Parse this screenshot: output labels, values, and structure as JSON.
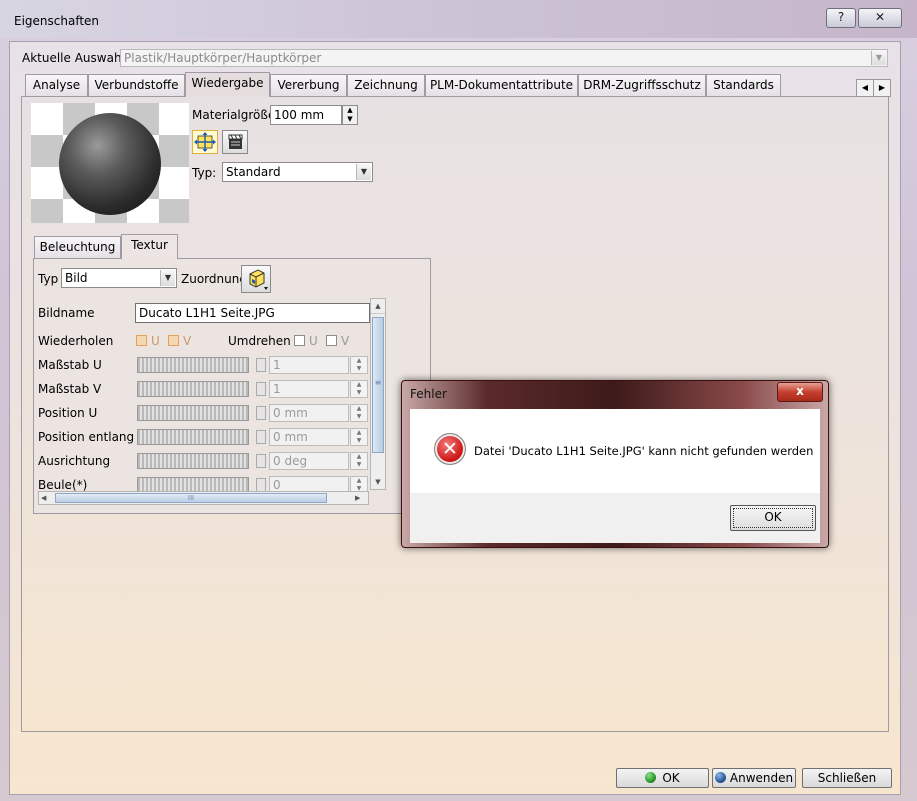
{
  "window": {
    "title": "Eigenschaften",
    "help_label": "?",
    "close_label": "✕"
  },
  "selection": {
    "label": "Aktuelle Auswahl:",
    "value": "Plastik/Hauptkörper/Hauptkörper"
  },
  "tabs": [
    "Analyse",
    "Verbundstoffe",
    "Wiedergabe",
    "Vererbung",
    "Zeichnung",
    "PLM-Dokumentattribute",
    "DRM-Zugriffsschutz",
    "Standards"
  ],
  "active_tab": "Wiedergabe",
  "render": {
    "material_size_label": "Materialgröße:",
    "material_size_value": "100 mm",
    "type_label": "Typ:",
    "type_value": "Standard"
  },
  "inner_tabs": [
    "Beleuchtung",
    "Textur"
  ],
  "active_inner_tab": "Textur",
  "texture": {
    "type_label": "Typ",
    "type_value": "Bild",
    "mapping_label": "Zuordnung",
    "image_name_label": "Bildname",
    "image_name_value": "Ducato L1H1 Seite.JPG",
    "repeat_label": "Wiederholen",
    "repeat_u": "U",
    "repeat_v": "V",
    "flip_label": "Umdrehen",
    "flip_u": "U",
    "flip_v": "V",
    "params": [
      {
        "label": "Maßstab U",
        "value": "1"
      },
      {
        "label": "Maßstab V",
        "value": "1"
      },
      {
        "label": "Position U",
        "value": "0 mm"
      },
      {
        "label": "Position entlang V",
        "value": "0 mm"
      },
      {
        "label": "Ausrichtung",
        "value": "0 deg"
      },
      {
        "label": "Beule(*)",
        "value": "0"
      }
    ]
  },
  "error_dialog": {
    "title": "Fehler",
    "close_label": "x",
    "message": "Datei 'Ducato L1H1 Seite.JPG'  kann nicht gefunden werden",
    "ok_label": "OK"
  },
  "footer": {
    "ok_label": "OK",
    "apply_label": "Anwenden",
    "close_label": "Schließen"
  },
  "colors": {
    "error_red": "#d01818",
    "ok_dot": "#2a9a2a",
    "apply_dot": "#2a5a9a"
  }
}
